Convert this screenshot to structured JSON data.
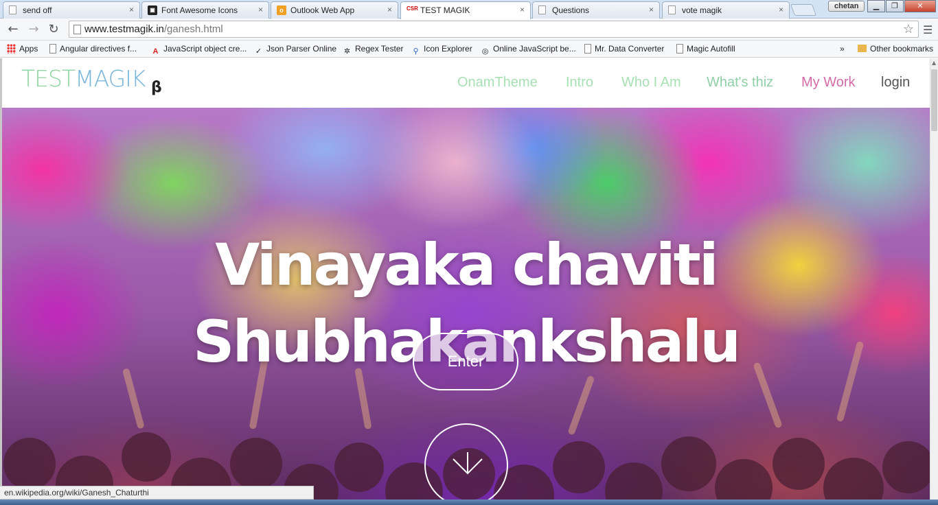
{
  "browser": {
    "tabs": [
      {
        "title": "send off",
        "icon": "doc-icon"
      },
      {
        "title": "Font Awesome Icons",
        "icon": "font-awesome-icon"
      },
      {
        "title": "Outlook Web App",
        "icon": "outlook-icon"
      },
      {
        "title": "TEST MAGIK",
        "icon": "csr-icon",
        "icon_text": "CSR",
        "active": true
      },
      {
        "title": "Questions",
        "icon": "doc-icon"
      },
      {
        "title": "vote magik",
        "icon": "doc-icon"
      }
    ],
    "close_glyph": "×",
    "user": "chetan",
    "window_controls": {
      "minimize": "▁",
      "maximize": "❐",
      "close": "✕"
    },
    "url": {
      "host": "www.testmagik.in",
      "path": "/ganesh.html"
    },
    "bookmarks": [
      {
        "label": "Apps",
        "icon": "apps-icon"
      },
      {
        "label": "Angular directives f...",
        "icon": "doc-icon"
      },
      {
        "label": "JavaScript object cre...",
        "icon": "adobe-icon"
      },
      {
        "label": "Json Parser Online",
        "icon": "json-icon"
      },
      {
        "label": "Regex Tester",
        "icon": "regex-icon"
      },
      {
        "label": "Icon Explorer",
        "icon": "search-icon"
      },
      {
        "label": "Online JavaScript be...",
        "icon": "beautifier-icon"
      },
      {
        "label": "Mr. Data Converter",
        "icon": "doc-icon"
      },
      {
        "label": "Magic Autofill",
        "icon": "doc-icon"
      }
    ],
    "bookmarks_overflow": "»",
    "other_bookmarks": "Other bookmarks",
    "status_url": "en.wikipedia.org/wiki/Ganesh_Chaturthi"
  },
  "site": {
    "logo": {
      "part1": "TEST",
      "part2": "MAGIK",
      "beta": "β"
    },
    "nav": [
      {
        "label": "OnamTheme",
        "color": "#a8e0b4"
      },
      {
        "label": "Intro",
        "color": "#a8e0b4"
      },
      {
        "label": "Who I Am",
        "color": "#a8e0b4"
      },
      {
        "label": "What's thiz",
        "color": "#8fd0a6"
      },
      {
        "label": "My Work",
        "color": "#d46aa8"
      },
      {
        "label": "login",
        "color": "#555555"
      }
    ],
    "hero": {
      "title_line1": "Vinayaka chaviti",
      "title_line2": "Shubhakankshalu",
      "enter_label": "Enter",
      "down_icon": "chevron-down-icon"
    }
  }
}
